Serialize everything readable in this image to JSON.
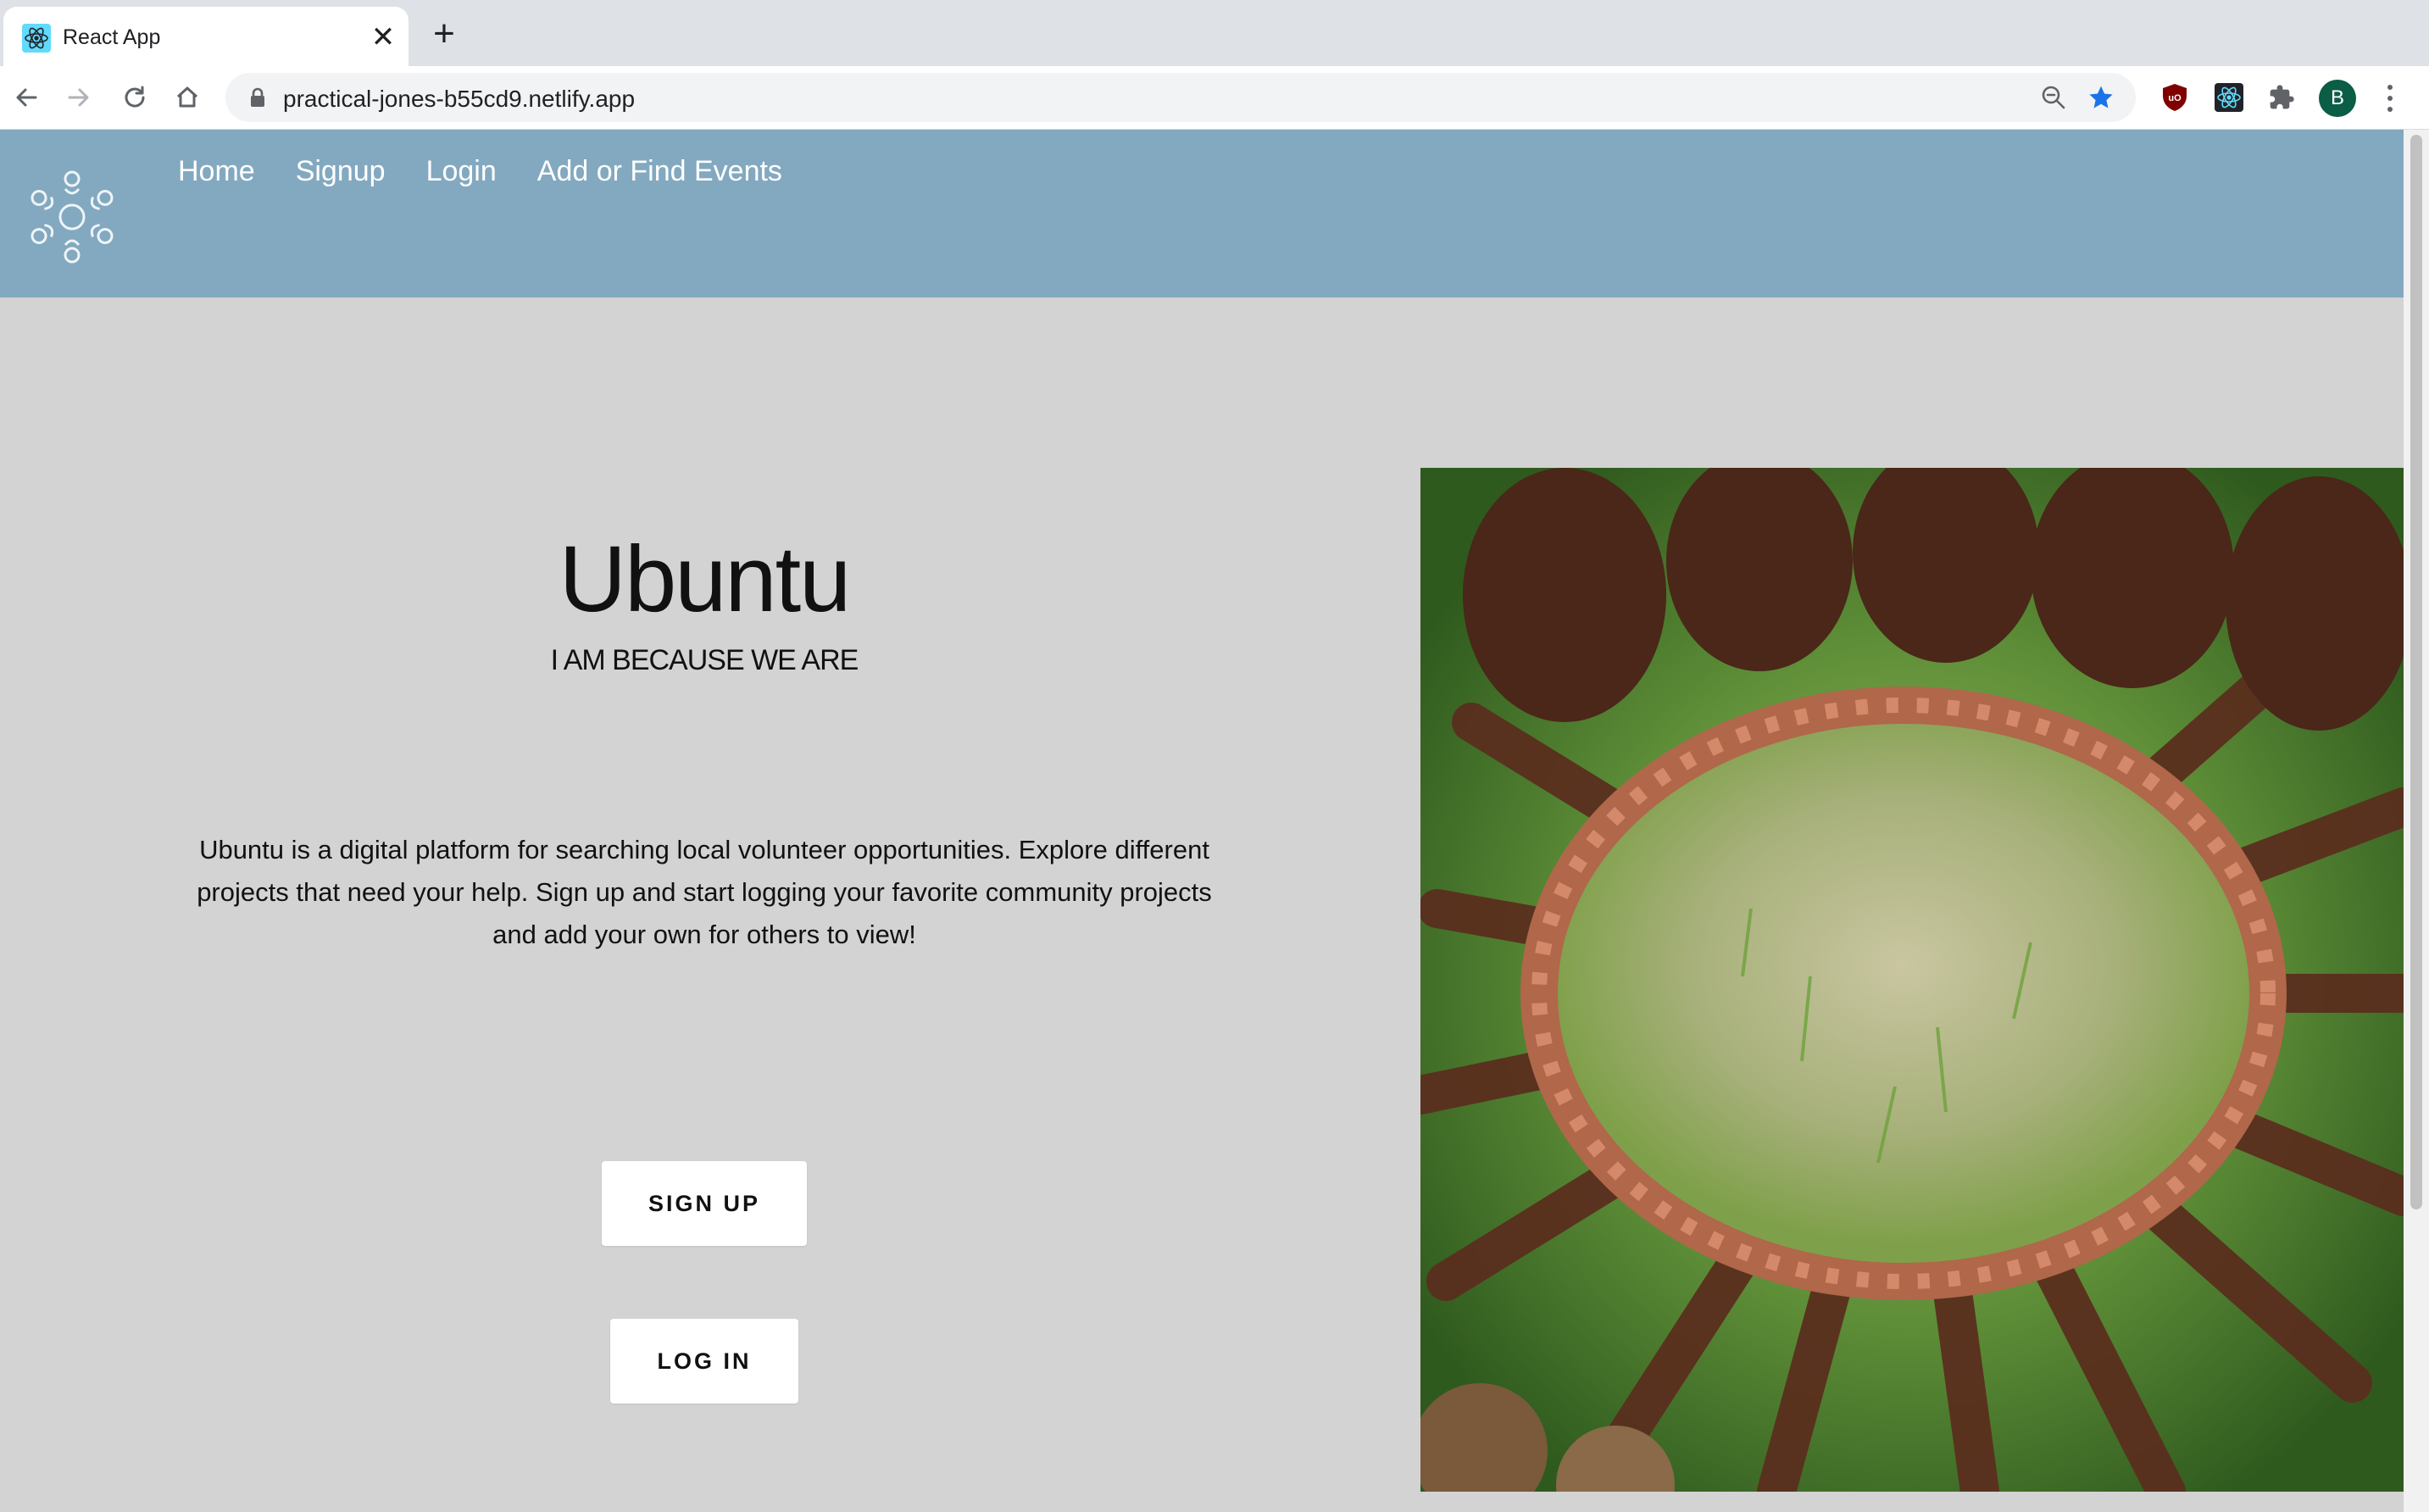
{
  "browser": {
    "tab_title": "React App",
    "url": "practical-jones-b55cd9.netlify.app",
    "profile_initial": "B"
  },
  "navbar": {
    "links": [
      "Home",
      "Signup",
      "Login",
      "Add or Find Events"
    ]
  },
  "hero": {
    "title": "Ubuntu",
    "subtitle": "I AM BECAUSE WE ARE",
    "description": "Ubuntu is a digital platform for searching local volunteer opportunities. Explore different projects that need your help. Sign up and start logging your favorite community projects and add your own for others to view!",
    "signup_button": "SIGN UP",
    "login_button": "LOG IN"
  },
  "icons": {
    "tab_favicon": "react-icon",
    "back": "arrow-left-icon",
    "forward": "arrow-right-icon",
    "reload": "reload-icon",
    "home": "home-icon",
    "zoom": "zoom-out-icon",
    "bookmark": "star-icon",
    "extensions": [
      "ublock-icon",
      "react-devtools-icon",
      "puzzle-icon"
    ]
  },
  "colors": {
    "navbar": "#83a9c0",
    "page_background": "#d3d3d3",
    "bookmark_star": "#1a73e8"
  }
}
